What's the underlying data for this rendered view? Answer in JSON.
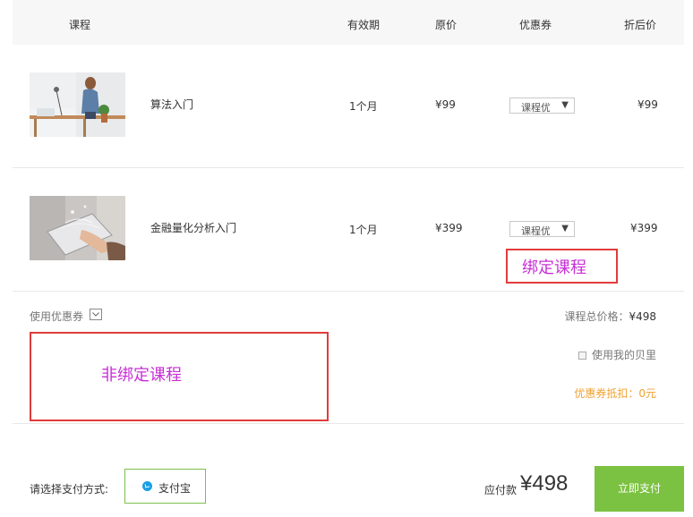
{
  "table": {
    "headers": {
      "course": "课程",
      "validity": "有效期",
      "original_price": "原价",
      "coupon": "优惠券",
      "discount_price": "折后价"
    },
    "rows": [
      {
        "name": "算法入门",
        "validity": "1个月",
        "original_price": "¥99",
        "coupon_selected": "课程优",
        "discount_price": "¥99",
        "thumb_icon": "office-woman-photo"
      },
      {
        "name": "金融量化分析入门",
        "validity": "1个月",
        "original_price": "¥399",
        "coupon_selected": "课程优",
        "discount_price": "¥399",
        "thumb_icon": "tablet-hands-photo"
      }
    ]
  },
  "coupon_section": {
    "use_coupon_label": "使用优惠券",
    "total_label": "课程总价格：",
    "total_value": "¥498",
    "beili_label": "使用我的贝里",
    "deduction": "优惠券抵扣：0元"
  },
  "annotations": {
    "bound_course": "绑定课程",
    "unbound_course": "非绑定课程"
  },
  "footer": {
    "payment_label": "请选择支付方式:",
    "alipay_label": "支付宝",
    "due_label": "应付款",
    "due_amount": "¥498",
    "pay_button": "立即支付"
  },
  "colors": {
    "accent_green": "#7cc242",
    "annotation_border": "#e03c3c",
    "annotation_text": "#c82fd6",
    "deduction_orange": "#f0a030",
    "alipay_blue": "#1a9fe6"
  }
}
